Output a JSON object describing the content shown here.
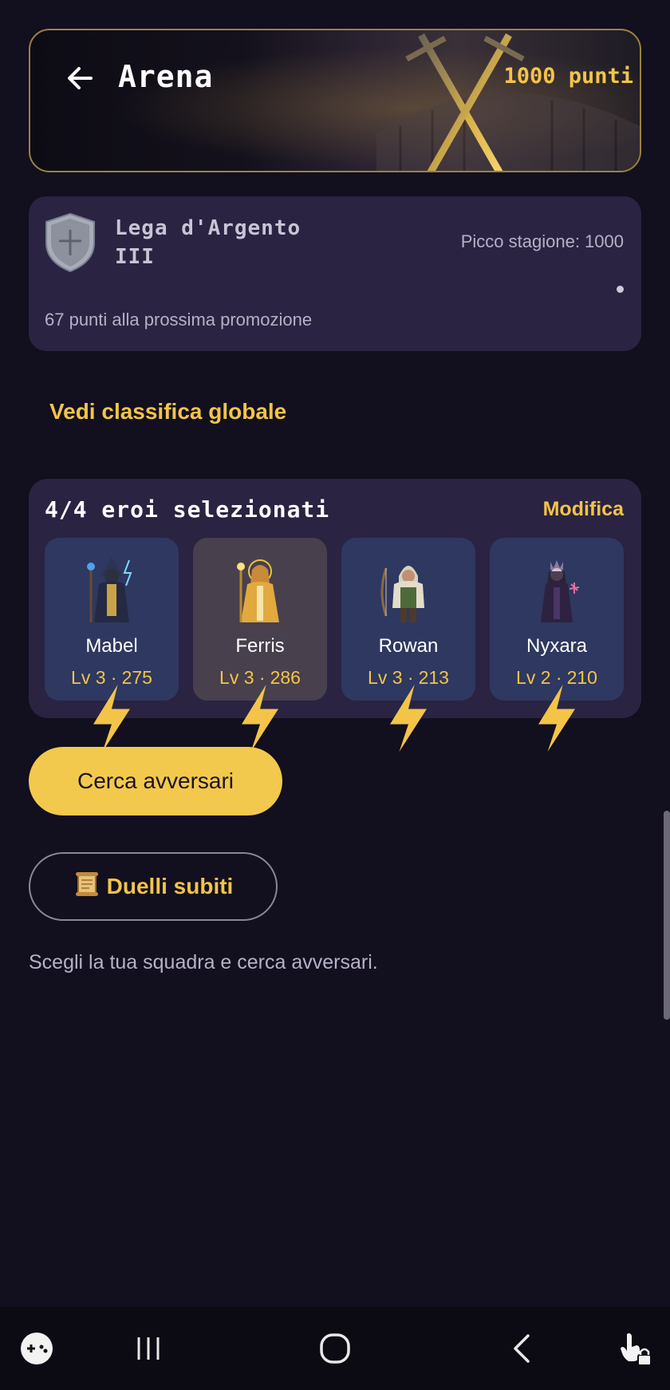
{
  "header": {
    "title": "Arena",
    "points": "1000 punti"
  },
  "league": {
    "name_line1": "Lega d'Argento",
    "name_line2": "III",
    "season_peak": "Picco stagione: 1000",
    "promotion_text": "67 punti alla prossima promozione"
  },
  "global_ranking_link": "Vedi classifica globale",
  "team": {
    "title": "4/4 eroi selezionati",
    "modify_label": "Modifica",
    "heroes": [
      {
        "name": "Mabel",
        "level": "Lv 3 ·",
        "power": "275"
      },
      {
        "name": "Ferris",
        "level": "Lv 3 ·",
        "power": "286"
      },
      {
        "name": "Rowan",
        "level": "Lv 3 ·",
        "power": "213"
      },
      {
        "name": "Nyxara",
        "level": "Lv 2 ·",
        "power": "210"
      }
    ]
  },
  "actions": {
    "search_label": "Cerca avversari",
    "duels_label": "Duelli subiti",
    "hint": "Scegli la tua squadra e cerca avversari."
  },
  "colors": {
    "accent": "#f2c94c",
    "background": "#120f1f",
    "card": "#2a2342"
  }
}
